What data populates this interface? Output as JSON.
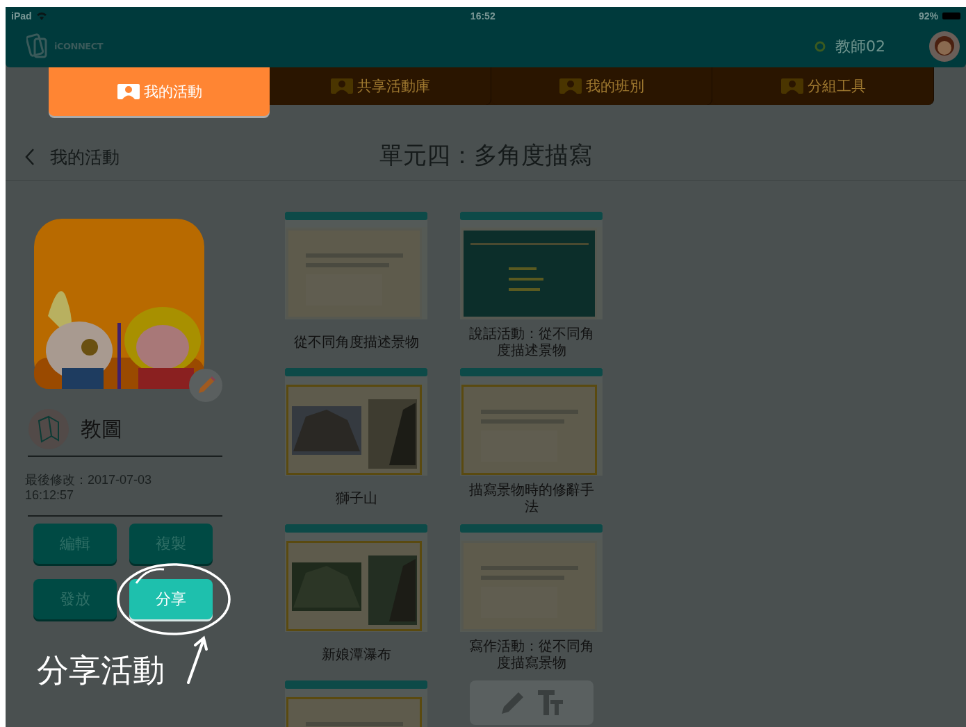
{
  "status_bar": {
    "device": "iPad",
    "time": "16:52",
    "battery": "92%"
  },
  "header": {
    "logo": "iCONNECT",
    "user": "教師02"
  },
  "tabs": [
    {
      "label": "我的活動",
      "selected": true
    },
    {
      "label": "共享活動庫",
      "selected": false
    },
    {
      "label": "我的班別",
      "selected": false
    },
    {
      "label": "分組工具",
      "selected": false
    }
  ],
  "page": {
    "back": "我的活動",
    "title": "單元四：多角度描寫"
  },
  "activity": {
    "subject": "教圖",
    "modified": "最後修改：2017-07-03 16:12:57"
  },
  "buttons": [
    {
      "label": "編輯",
      "highlighted": false
    },
    {
      "label": "複製",
      "highlighted": false
    },
    {
      "label": "發放",
      "highlighted": false
    },
    {
      "label": "分享",
      "highlighted": true
    }
  ],
  "annotation": "分享活動",
  "cards": [
    {
      "kind": "slide",
      "title": "從不同角度描述景物"
    },
    {
      "kind": "slide",
      "title": "說話活動：從不同角度描述景物"
    },
    {
      "kind": "slide",
      "title": "獅子山"
    },
    {
      "kind": "slide",
      "title": "描寫景物時的修辭手法"
    },
    {
      "kind": "slide",
      "title": "新娘潭瀑布"
    },
    {
      "kind": "slide",
      "title": "寫作活動：從不同角度描寫景物"
    },
    {
      "kind": "slide"
    },
    {
      "kind": "new"
    }
  ]
}
